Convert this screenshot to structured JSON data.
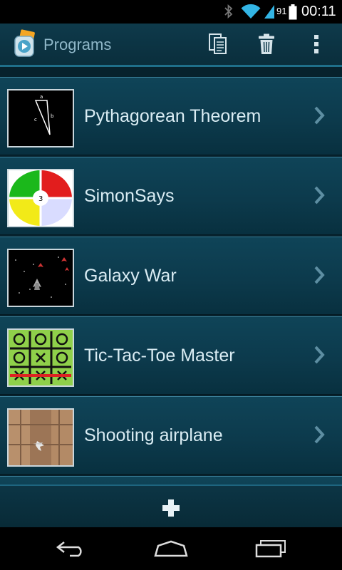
{
  "status_bar": {
    "battery_level": "91",
    "time": "00:11",
    "icons": [
      "bluetooth-icon",
      "wifi-icon",
      "battery-icon"
    ]
  },
  "action_bar": {
    "title": "Programs",
    "actions": [
      "copy-icon",
      "trash-icon",
      "overflow-menu-icon"
    ]
  },
  "programs": [
    {
      "name": "Pythagorean Theorem",
      "thumbnail": "triangle-thumbnail",
      "thumb_labels": [
        "a",
        "b",
        "c"
      ]
    },
    {
      "name": "SimonSays",
      "thumbnail": "simon-says-thumbnail",
      "thumb_labels": [
        "3"
      ]
    },
    {
      "name": "Galaxy War",
      "thumbnail": "galaxy-war-thumbnail"
    },
    {
      "name": "Tic-Tac-Toe Master",
      "thumbnail": "tic-tac-toe-thumbnail"
    },
    {
      "name": "Shooting airplane",
      "thumbnail": "airplane-thumbnail"
    },
    {
      "name": "",
      "thumbnail": "partial-thumbnail"
    }
  ],
  "bottom_bar": {
    "action": "add-icon"
  },
  "nav_bar": {
    "buttons": [
      "back-icon",
      "home-icon",
      "recent-apps-icon"
    ]
  },
  "colors": {
    "row_text": "#d9ecf3",
    "title_text": "#8fb7c8",
    "accent": "#1f6f8a"
  }
}
